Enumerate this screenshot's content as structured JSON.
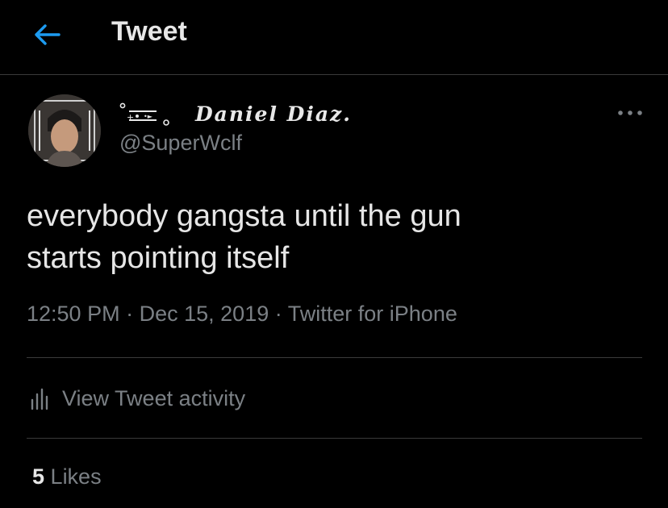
{
  "header": {
    "title": "Tweet",
    "back_icon": "arrow-left-icon",
    "back_color": "#1d9bf0"
  },
  "author": {
    "display_name": "Daniel Diaz.",
    "handle": "@SuperWclf"
  },
  "tweet": {
    "text": "everybody gangsta until the gun\nstarts pointing itself",
    "time": "12:50 PM",
    "date": "Dec 15, 2019",
    "source": "Twitter for iPhone",
    "separator": "·"
  },
  "activity": {
    "label": "View Tweet activity",
    "icon": "bar-chart-icon"
  },
  "likes": {
    "count": "5",
    "label": "Likes"
  },
  "colors": {
    "background": "#000000",
    "primary_text": "#e6e6e6",
    "secondary_text": "#7b8085",
    "divider": "#3a3a3a",
    "accent": "#1d9bf0"
  }
}
